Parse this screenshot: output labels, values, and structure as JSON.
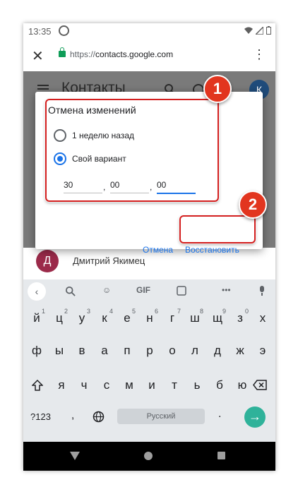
{
  "status_bar": {
    "time": "13:35"
  },
  "browser": {
    "url_scheme": "https://",
    "url_domain": "contacts.google.com",
    "close_icon": "close-icon",
    "menu_icon": "more-vert-icon"
  },
  "app": {
    "title": "Контакты",
    "avatar_letter": "К"
  },
  "contact": {
    "avatar_letter": "Д",
    "name": "Дмитрий Якимец"
  },
  "dialog": {
    "title": "Отмена изменений",
    "options": [
      {
        "label": "1 неделю назад",
        "selected": false
      },
      {
        "label": "Свой вариант",
        "selected": true
      }
    ],
    "fields": [
      "30",
      "00",
      "00"
    ],
    "separator": ",",
    "cancel_label": "Отмена",
    "restore_label": "Восстановить"
  },
  "annotations": {
    "badge1": "1",
    "badge2": "2",
    "color": "#d41f1f"
  },
  "keyboard": {
    "toolbar": {
      "gif": "GIF"
    },
    "row1": [
      "й",
      "ц",
      "у",
      "к",
      "е",
      "н",
      "г",
      "ш",
      "щ",
      "з",
      "х"
    ],
    "row1_hints": [
      "1",
      "2",
      "3",
      "4",
      "5",
      "6",
      "7",
      "8",
      "9",
      "0",
      ""
    ],
    "row2": [
      "ф",
      "ы",
      "в",
      "а",
      "п",
      "р",
      "о",
      "л",
      "д",
      "ж",
      "э"
    ],
    "row3": [
      "я",
      "ч",
      "с",
      "м",
      "и",
      "т",
      "ь",
      "б",
      "ю"
    ],
    "symbols_key": "?123",
    "comma_key": ",",
    "space_label": "Русский",
    "period_key": ".",
    "enter_color": "#2fb29a"
  }
}
